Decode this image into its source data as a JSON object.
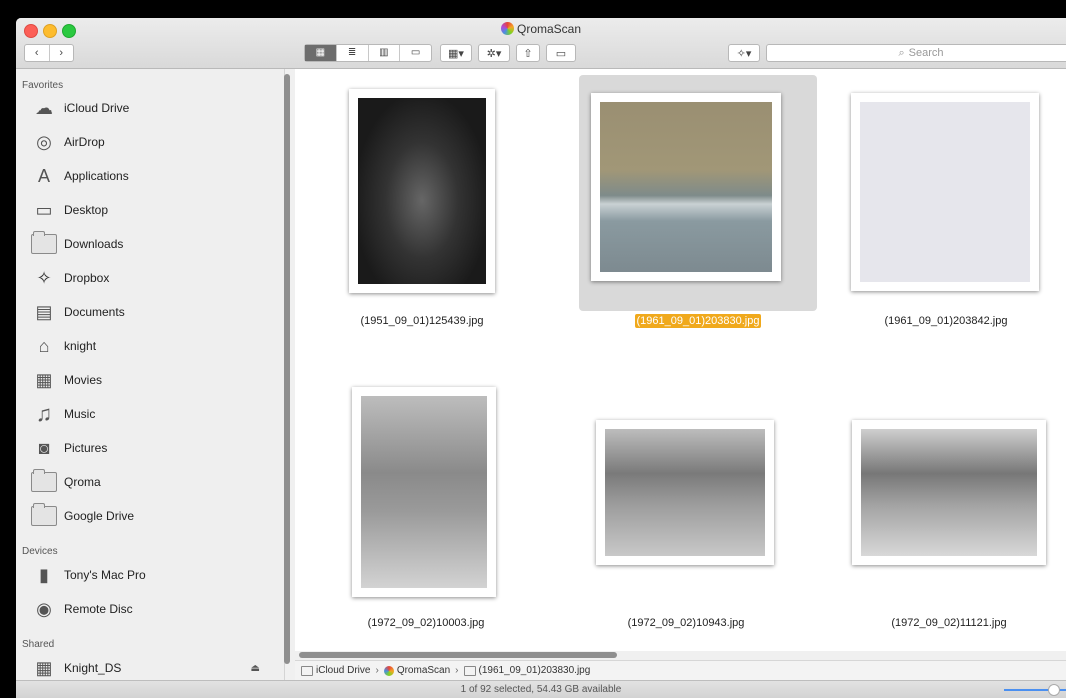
{
  "window": {
    "title": "QromaScan"
  },
  "toolbar": {
    "back": "‹",
    "forward": "›",
    "views": [
      "▦",
      "≣",
      "▥",
      "▭"
    ],
    "arrange": "▦▾",
    "action": "✲▾",
    "share": "⇧",
    "tag": "▭",
    "dropbox": "✧▾",
    "search_placeholder": "Search"
  },
  "sidebar": {
    "favorites_label": "Favorites",
    "favorites": [
      {
        "label": "iCloud Drive",
        "icon": "☁"
      },
      {
        "label": "AirDrop",
        "icon": "◎"
      },
      {
        "label": "Applications",
        "icon": "A"
      },
      {
        "label": "Desktop",
        "icon": "▭"
      },
      {
        "label": "Downloads",
        "icon": ""
      },
      {
        "label": "Dropbox",
        "icon": "✧"
      },
      {
        "label": "Documents",
        "icon": "▤"
      },
      {
        "label": "knight",
        "icon": "⌂"
      },
      {
        "label": "Movies",
        "icon": "▦"
      },
      {
        "label": "Music",
        "icon": "♫"
      },
      {
        "label": "Pictures",
        "icon": "◙"
      },
      {
        "label": "Qroma",
        "icon": ""
      },
      {
        "label": "Google Drive",
        "icon": ""
      }
    ],
    "devices_label": "Devices",
    "devices": [
      {
        "label": "Tony's Mac Pro",
        "icon": "▮"
      },
      {
        "label": "Remote Disc",
        "icon": "◉"
      }
    ],
    "shared_label": "Shared",
    "shared": [
      {
        "label": "Knight_DS",
        "icon": "▦",
        "eject": "⏏"
      }
    ]
  },
  "files": [
    {
      "name": "(1951_09_01)125439.jpg",
      "selected": false
    },
    {
      "name": "(1961_09_01)203830.jpg",
      "selected": true
    },
    {
      "name": "(1961_09_01)203842.jpg",
      "selected": false
    },
    {
      "name": "(1972_09_02)10003.jpg",
      "selected": false
    },
    {
      "name": "(1972_09_02)10943.jpg",
      "selected": false
    },
    {
      "name": "(1972_09_02)11121.jpg",
      "selected": false
    }
  ],
  "pathbar": {
    "items": [
      "iCloud Drive",
      "QromaScan",
      "(1961_09_01)203830.jpg"
    ]
  },
  "status": {
    "text": "1 of 92 selected, 54.43 GB available"
  }
}
